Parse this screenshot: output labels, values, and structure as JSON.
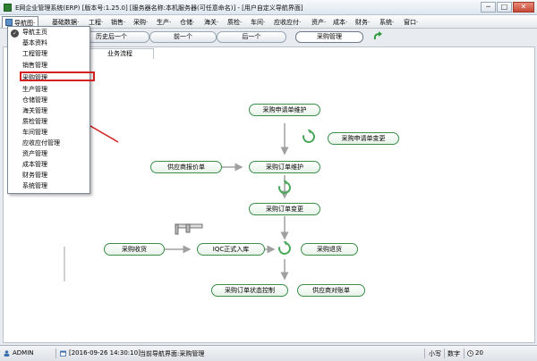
{
  "window": {
    "title": "E网企业管理系统(ERP) [版本号:1.25.0] [服务器名称:本机服务器(可任意命名)] - [用户自定义导航界面]",
    "controls": [
      "─",
      "□",
      "✕"
    ]
  },
  "menubar": {
    "items": [
      {
        "label": "导航图·",
        "active": true
      },
      {
        "label": "基础数据·"
      },
      {
        "label": "工程·"
      },
      {
        "label": "销售·"
      },
      {
        "label": "采购·"
      },
      {
        "label": "生产·"
      },
      {
        "label": "仓储·"
      },
      {
        "label": "海关·"
      },
      {
        "label": "质检·"
      },
      {
        "label": "车间·"
      },
      {
        "label": "应收应付·"
      },
      {
        "label": "资产·"
      },
      {
        "label": "成本·"
      },
      {
        "label": "财务·"
      },
      {
        "label": "系统·"
      },
      {
        "label": "窗口·"
      }
    ]
  },
  "toolbar": {
    "tabs": [
      "历史后一个",
      "前一个",
      "后一个",
      "采购管理"
    ]
  },
  "panel": {
    "tab_label": "业务流程"
  },
  "dropdown": {
    "items": [
      "导航主页",
      "基本资料",
      "工程管理",
      "销售管理",
      "采购管理",
      "生产管理",
      "仓储管理",
      "海关管理",
      "质检管理",
      "车间管理",
      "应收应付管理",
      "资产管理",
      "成本管理",
      "财务管理",
      "系统管理"
    ],
    "selected": "采购管理"
  },
  "flow": {
    "purchase_request": "采购申请单维护",
    "request_change": "采购申请单变更",
    "supplier_quote": "供应商报价单",
    "order_maintain": "采购订单维护",
    "order_change": "采购订单变更",
    "receiving": "采购收货",
    "iqc_stock_in": "IQC正式入库",
    "purchase_return": "采购退货",
    "order_status": "采购订单状态控制",
    "supplier_statement": "供应商对账单"
  },
  "statusbar": {
    "user": "ADMIN",
    "datetime": "[2016-09-26 14:30:10]",
    "current_view": "当前导航界面:采购管理",
    "small_label": "小写",
    "num_label": "数字",
    "clock": "20"
  },
  "colors": {
    "flow_border": "#3a8e4a",
    "highlight": "#d32020",
    "arrow": "#a0a0a0"
  }
}
